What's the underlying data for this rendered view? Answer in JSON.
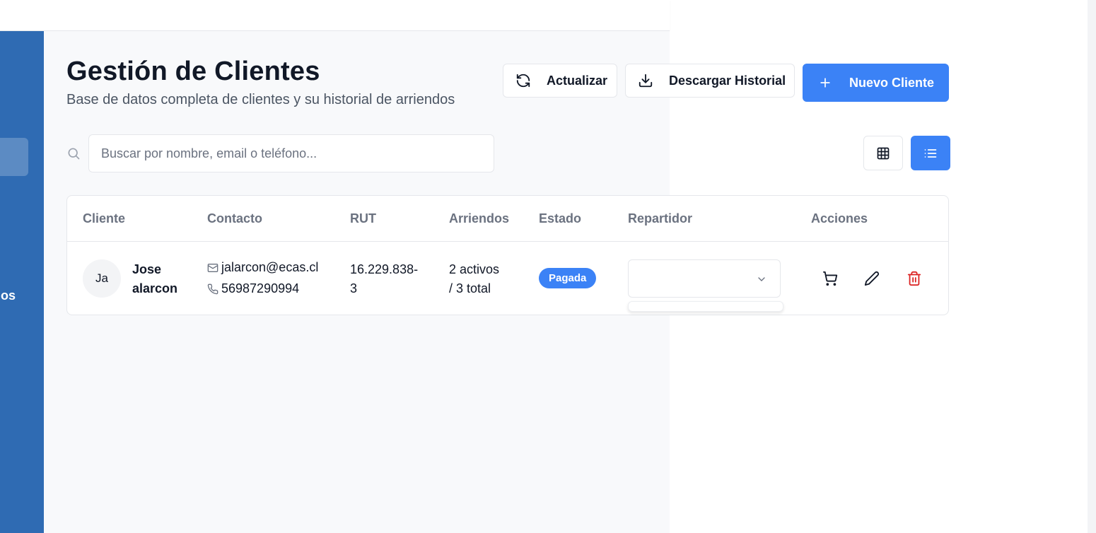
{
  "page": {
    "title": "Gestión de Clientes",
    "subtitle": "Base de datos completa de clientes y su historial de arriendos"
  },
  "sidebar": {
    "partial_item_label": "ios"
  },
  "toolbar": {
    "refresh_label": "Actualizar",
    "download_label": "Descargar Historial",
    "new_client_label": "Nuevo Cliente"
  },
  "search": {
    "placeholder": "Buscar por nombre, email o teléfono...",
    "value": ""
  },
  "view_toggle": {
    "active": "list",
    "options": [
      "grid",
      "list"
    ]
  },
  "table": {
    "headers": {
      "cliente": "Cliente",
      "contacto": "Contacto",
      "rut": "RUT",
      "arriendos": "Arriendos",
      "estado": "Estado",
      "repartidor": "Repartidor",
      "acciones": "Acciones"
    },
    "rows": [
      {
        "initials": "Ja",
        "name_line1": "Jose",
        "name_line2": "alarcon",
        "email": "jalarcon@ecas.cl",
        "phone": "56987290994",
        "rut_line1": "16.229.838-",
        "rut_line2": "3",
        "rentals_line1": "2 activos",
        "rentals_line2": "/ 3 total",
        "status": "Pagada",
        "repartidor": ""
      }
    ]
  },
  "colors": {
    "sidebar": "#2f6bb3",
    "primary": "#3b82f6",
    "danger": "#dc2626",
    "muted_text": "#6b7280"
  }
}
